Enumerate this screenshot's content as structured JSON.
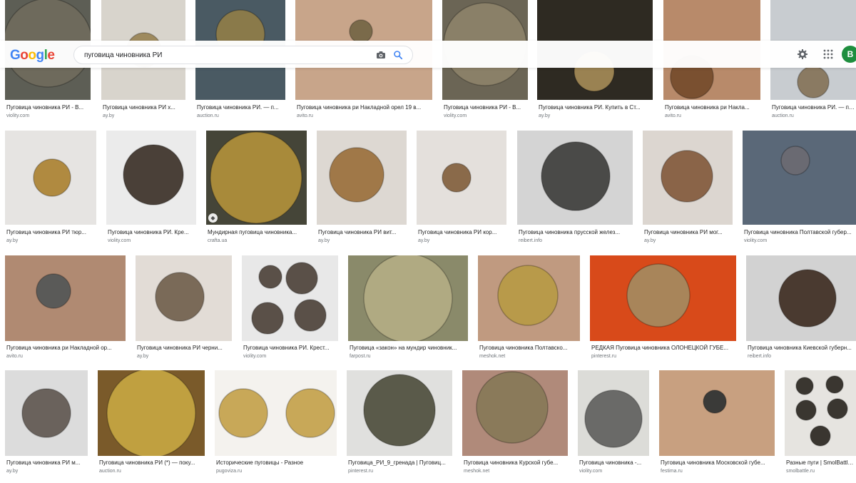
{
  "header": {
    "logo": {
      "letters": [
        "G",
        "o",
        "o",
        "g",
        "l",
        "e"
      ],
      "colors": [
        "#4285F4",
        "#EA4335",
        "#FBBC05",
        "#4285F4",
        "#34A853",
        "#EA4335"
      ]
    },
    "search_value": "пуговица чиновника РИ",
    "avatar_letter": "B",
    "accent": "#1a73e8"
  },
  "results": [
    {
      "caption": "Пуговица чиновника РИ - В...",
      "source": "violity.com",
      "bg": "#5d5e55",
      "button": "#6e6a5c"
    },
    {
      "caption": "Пуговица чиновника РИ х...",
      "source": "ay.by",
      "bg": "#d8d4cc",
      "button": "#9e8a5e"
    },
    {
      "caption": "Пуговица чиновника РИ. — п...",
      "source": "auction.ru",
      "bg": "#4a5a63",
      "button": "#8a7a4a"
    },
    {
      "caption": "Пуговица чиновника ри Накладной орел 19 в...",
      "source": "avito.ru",
      "bg": "#c8a58a",
      "button": "#7a6a4a"
    },
    {
      "caption": "Пуговица чиновника РИ - В...",
      "source": "violity.com",
      "bg": "#6b6555",
      "button": "#8a8068"
    },
    {
      "caption": "Пуговица чиновника РИ. Купить в Ст...",
      "source": "ay.by",
      "bg": "#2e2a22",
      "button": "#9a8252"
    },
    {
      "caption": "Пуговица чиновника ри Накла...",
      "source": "avito.ru",
      "bg": "#b88a6a",
      "button": "#7a5030"
    },
    {
      "caption": "Пуговица чиновника РИ. — пок...",
      "source": "auction.ru",
      "bg": "#c8ccd0",
      "button": "#8a7a62"
    },
    {
      "caption": "Пуговица чиновника РИ тюр...",
      "source": "ay.by",
      "bg": "#e6e4e2",
      "button": "#b08a40"
    },
    {
      "caption": "Пуговица чиновника РИ. Кре...",
      "source": "violity.com",
      "bg": "#ebebeb",
      "button": "#4a4038"
    },
    {
      "caption": "Мундирная пуговица чиновника...",
      "source": "crafta.ua",
      "bg": "#454538",
      "button": "#a88a3a"
    },
    {
      "caption": "Пуговица чиновника РИ вит...",
      "source": "ay.by",
      "bg": "#ddd8d2",
      "button": "#a07848"
    },
    {
      "caption": "Пуговица чиновника РИ кор...",
      "source": "ay.by",
      "bg": "#e4e0dc",
      "button": "#8a6a4a"
    },
    {
      "caption": "Пуговица чиновника прусской желез...",
      "source": "reibert.info",
      "bg": "#d4d4d4",
      "button": "#4a4a48"
    },
    {
      "caption": "Пуговица чиновника РИ мог...",
      "source": "ay.by",
      "bg": "#dcd6d0",
      "button": "#8a6448"
    },
    {
      "caption": "Пуговица чиновника Полтавской губер...",
      "source": "violity.com",
      "bg": "#5a6878",
      "button": "#6a6a72"
    },
    {
      "caption": "Пуговица чиновника ри Накладной ор...",
      "source": "avito.ru",
      "bg": "#b08a72",
      "button": "#5a5a58"
    },
    {
      "caption": "Пуговица чиновника РИ черни...",
      "source": "ay.by",
      "bg": "#e2dcd6",
      "button": "#7a6a58"
    },
    {
      "caption": "Пуговица чиновника РИ. Крест...",
      "source": "violity.com",
      "bg": "#e8e8e8",
      "button": "#5a5048"
    },
    {
      "caption": "Пуговица «закон» на мундир чиновник...",
      "source": "farpost.ru",
      "bg": "#8a8a6a",
      "button": "#b0aa82"
    },
    {
      "caption": "Пуговица чиновника Полтавско...",
      "source": "meshok.net",
      "bg": "#c09a80",
      "button": "#b89a4a"
    },
    {
      "caption": "РЕДКАЯ Пуговица чиновника ОЛОНЕЦКОЙ ГУБЕ...",
      "source": "pinterest.ru",
      "bg": "#d84a1a",
      "button": "#a8855a"
    },
    {
      "caption": "Пуговица чиновника Киевской губерн...",
      "source": "reibert.info",
      "bg": "#d2d2d2",
      "button": "#4a3a30"
    },
    {
      "caption": "Пуговица чиновника РИ м...",
      "source": "ay.by",
      "bg": "#dcdcdc",
      "button": "#6a625c"
    },
    {
      "caption": "Пуговица чиновника РИ (*) — поку...",
      "source": "auction.ru",
      "bg": "#7a5a2a",
      "button": "#c0a040"
    },
    {
      "caption": "Исторические пуговицы - Разное",
      "source": "pugoviza.ru",
      "bg": "#f4f2ee",
      "button": "#c8a858"
    },
    {
      "caption": "Пуговица_РИ_9_гренада | Пуговиц...",
      "source": "pinterest.ru",
      "bg": "#e0e0de",
      "button": "#5a5a4a"
    },
    {
      "caption": "Пуговица чиновника Курской губе...",
      "source": "meshok.net",
      "bg": "#b08a7a",
      "button": "#8a7a5a"
    },
    {
      "caption": "Пуговица чиновника -...",
      "source": "violity.com",
      "bg": "#dcdcd8",
      "button": "#6a6a68"
    },
    {
      "caption": "Пуговица чиновника Московской губе...",
      "source": "festima.ru",
      "bg": "#c8a080",
      "button": "#3a3a38"
    },
    {
      "caption": "Разные пуги | SmolBattle.ru",
      "source": "smolbattle.ru",
      "bg": "#e6e4e0",
      "button": "#3a3630"
    }
  ]
}
